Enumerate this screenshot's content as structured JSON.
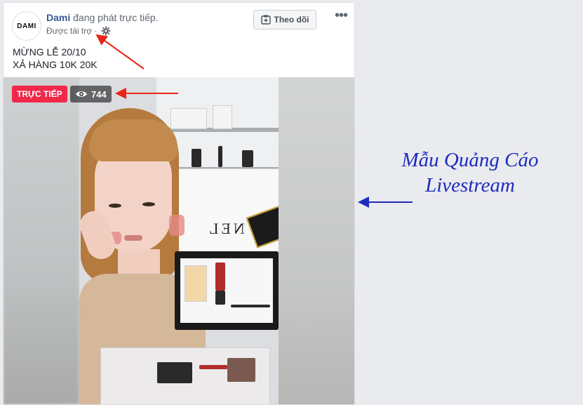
{
  "post": {
    "avatar_text": "DAMI",
    "page_name": "Dami",
    "status_text": " đang phát trực tiếp.",
    "sponsored_label": "Được tài trợ",
    "separator": " · ",
    "follow_label": "Theo dõi",
    "more_label": "•••",
    "text_lines": [
      "MỪNG LỄ 20/10",
      "XẢ HÀNG 10K 20K"
    ]
  },
  "video": {
    "live_label": "TRỰC TIẾP",
    "viewer_count": "744",
    "product_text": "NEL"
  },
  "annotation": {
    "line1": "Mẫu Quảng Cáo",
    "line2": "Livestream",
    "text_color": "#1d2bbf"
  },
  "colors": {
    "brand_link": "#385898",
    "live_red": "#f02849",
    "arrow_red": "#e8261a",
    "arrow_blue": "#1d2bbf"
  },
  "icons": [
    "gear-icon",
    "follow-icon",
    "more-icon",
    "eye-icon"
  ]
}
